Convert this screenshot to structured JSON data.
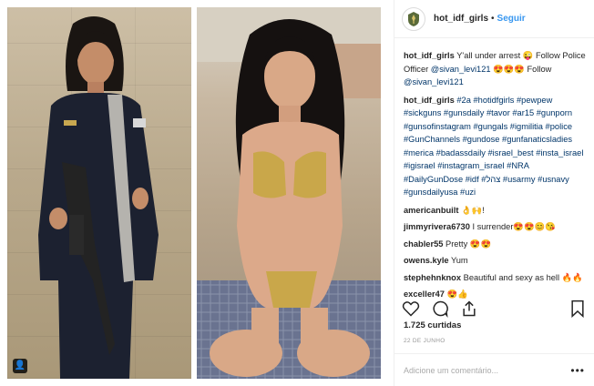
{
  "post": {
    "username": "hot_idf_girls",
    "separator": "•",
    "follow_label": "Seguir"
  },
  "comments": [
    {
      "user": "hot_idf_girls",
      "parts": [
        {
          "t": " Y'all under arrest 😜 Follow Police Officer ",
          "link": false
        },
        {
          "t": "@sivan_levi121",
          "link": true
        },
        {
          "t": " 😍😍😍 Follow ",
          "link": false
        },
        {
          "t": "@sivan_levi121",
          "link": true
        }
      ]
    },
    {
      "user": "hot_idf_girls",
      "parts": [
        {
          "t": " #2a #hotidfgirls #pewpew #sickguns #gunsdaily #tavor #ar15 #gunporn #gunsofinstagram #gungals #igmilitia #police #GunChannels #gundose #gunfanaticsladies #merica #badassdaily #israel_best #insta_israel #igisrael #instagram_israel #NRA #DailyGunDose #idf #צהל #usarmy #usnavy #gunsdailyusa #uzi",
          "link": true
        }
      ]
    },
    {
      "user": "americanbuilt",
      "parts": [
        {
          "t": " 👌🙌!",
          "link": false
        }
      ]
    },
    {
      "user": "jimmyrivera6730",
      "parts": [
        {
          "t": " I surrender😍😍😊😘",
          "link": false
        }
      ]
    },
    {
      "user": "chabler55",
      "parts": [
        {
          "t": " Pretty 😍😍",
          "link": false
        }
      ]
    },
    {
      "user": "owens.kyle",
      "parts": [
        {
          "t": " Yum",
          "link": false
        }
      ]
    },
    {
      "user": "stephehnknox",
      "parts": [
        {
          "t": " Beautiful and sexy as hell 🔥🔥",
          "link": false
        }
      ]
    },
    {
      "user": "exceller47",
      "parts": [
        {
          "t": " 😍👍",
          "link": false
        }
      ]
    }
  ],
  "likes": "1.725 curtidas",
  "date": "22 DE JUNHO",
  "comment_box": {
    "placeholder": "Adicione um comentário..."
  },
  "more_label": "•••",
  "icons": {
    "like": "heart-icon",
    "comment": "comment-icon",
    "share": "share-icon",
    "save": "bookmark-icon",
    "tag": "user-tag-icon"
  },
  "colors": {
    "follow": "#3897f0",
    "link": "#003569",
    "muted": "#999999"
  }
}
